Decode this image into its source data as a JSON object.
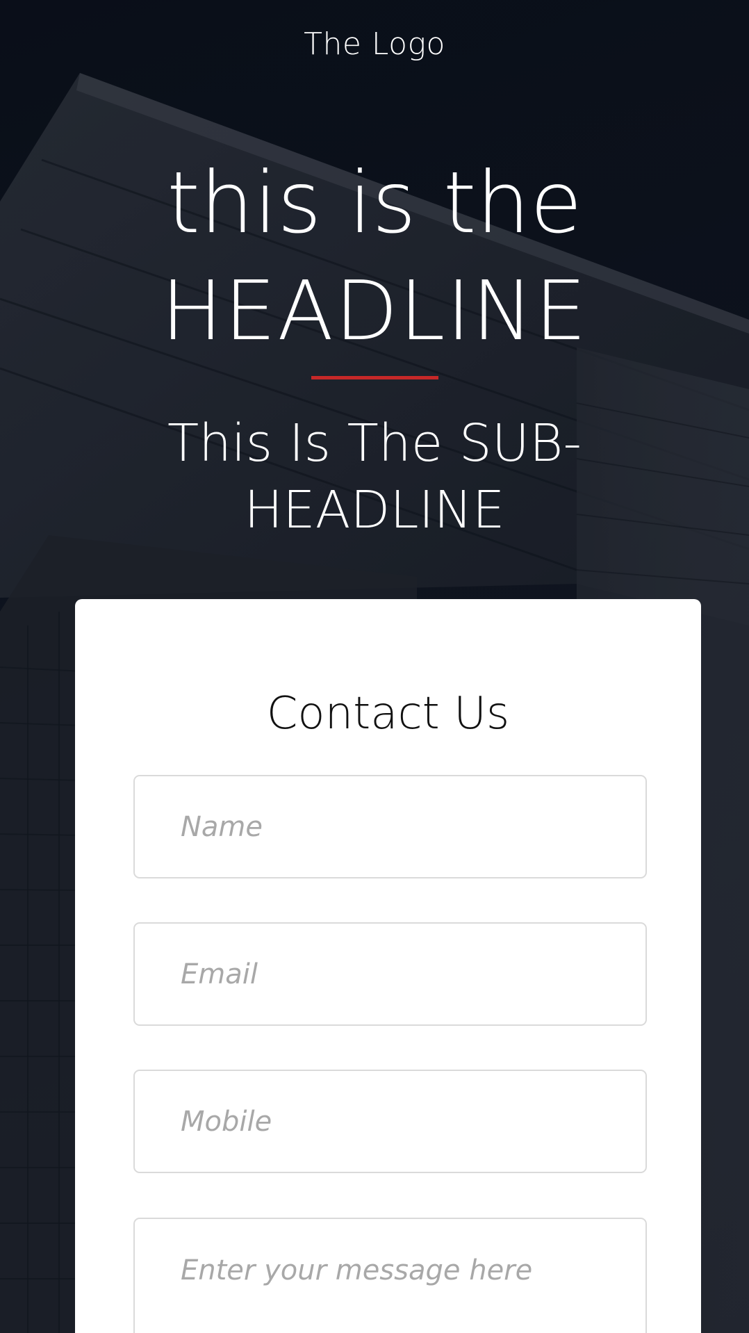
{
  "header": {
    "logo_text": "The Logo"
  },
  "hero": {
    "headline_line1": "this is the",
    "headline_line2": "HEADLINE",
    "subheadline": "This Is The SUB-HEADLINE"
  },
  "form": {
    "title": "Contact Us",
    "fields": {
      "name": {
        "value": "",
        "placeholder": "Name"
      },
      "email": {
        "value": "",
        "placeholder": "Email"
      },
      "mobile": {
        "value": "",
        "placeholder": "Mobile"
      },
      "message": {
        "value": "",
        "placeholder": "Enter your message here"
      }
    }
  },
  "colors": {
    "background": "#0c111b",
    "accent_divider": "#c62828",
    "card": "#ffffff",
    "field_border": "#dadada",
    "placeholder": "#a8a8a8"
  }
}
